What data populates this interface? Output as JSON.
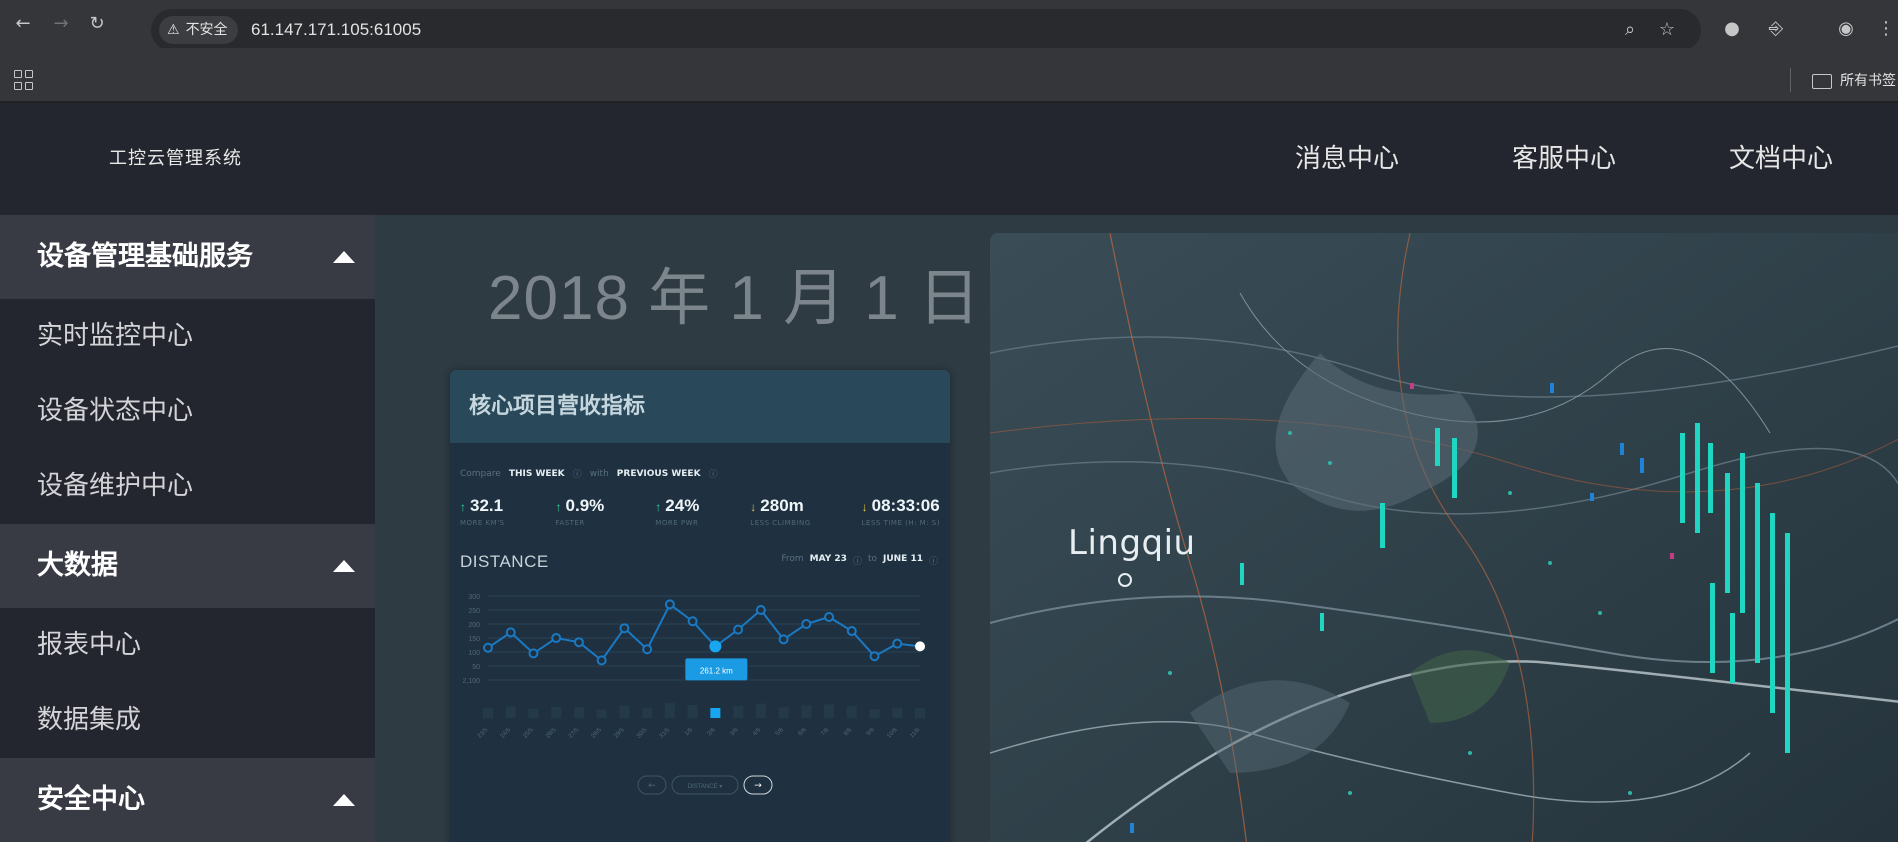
{
  "browser": {
    "security_label": "不安全",
    "url": "61.147.171.105:61005",
    "bookmarks_folder": "所有书签"
  },
  "app": {
    "title": "工控云管理系统",
    "top_nav": [
      "消息中心",
      "客服中心",
      "文档中心"
    ]
  },
  "sidebar": {
    "groups": [
      {
        "label": "设备管理基础服务",
        "items": [
          "实时监控中心",
          "设备状态中心",
          "设备维护中心"
        ]
      },
      {
        "label": "大数据",
        "items": [
          "报表中心",
          "数据集成"
        ]
      },
      {
        "label": "安全中心",
        "items": []
      }
    ]
  },
  "main": {
    "date": "2018 年 1 月 1 日",
    "card": {
      "title": "核心项目营收指标",
      "compare_label": "Compare",
      "this_week": "THIS WEEK",
      "with_label": "with",
      "previous_week": "PREVIOUS WEEK",
      "stats": [
        {
          "dir": "up",
          "value": "32.1",
          "sub": "MORE KM'S"
        },
        {
          "dir": "up",
          "value": "0.9%",
          "sub": "FASTER"
        },
        {
          "dir": "up",
          "value": "24%",
          "sub": "MORE PWR"
        },
        {
          "dir": "down",
          "value": "280m",
          "sub": "LESS CLIMBING"
        },
        {
          "dir": "down",
          "value": "08:33:06",
          "sub": "LESS TIME (H: M: S)"
        }
      ],
      "distance_title": "DISTANCE",
      "from_label": "From",
      "from_date": "MAY 23",
      "to_label": "to",
      "to_date": "JUNE 11",
      "tooltip": "261.2 km",
      "pager_select": "DISTANCE"
    },
    "map_label": "Lingqiu"
  },
  "chart_data": {
    "type": "line",
    "title": "DISTANCE",
    "y_ticks": [
      "300",
      "250",
      "200",
      "150",
      "100",
      "50",
      "2,100"
    ],
    "x_ticks": [
      "23/5",
      "24/5",
      "25/5",
      "26/5",
      "27/5",
      "28/5",
      "29/5",
      "30/5",
      "31/5",
      "1/6",
      "2/6",
      "3/6",
      "4/6",
      "5/6",
      "6/6",
      "7/6",
      "8/6",
      "9/6",
      "10/6",
      "11/6"
    ],
    "values": [
      115,
      170,
      95,
      150,
      135,
      70,
      185,
      110,
      270,
      210,
      120,
      180,
      250,
      145,
      200,
      225,
      175,
      85,
      130,
      120
    ],
    "highlight_index": 10,
    "ylim": [
      0,
      300
    ],
    "colors": {
      "line": "#1a79c2",
      "highlight": "#19a6f0",
      "tooltip_bg": "#1b9be3"
    }
  }
}
